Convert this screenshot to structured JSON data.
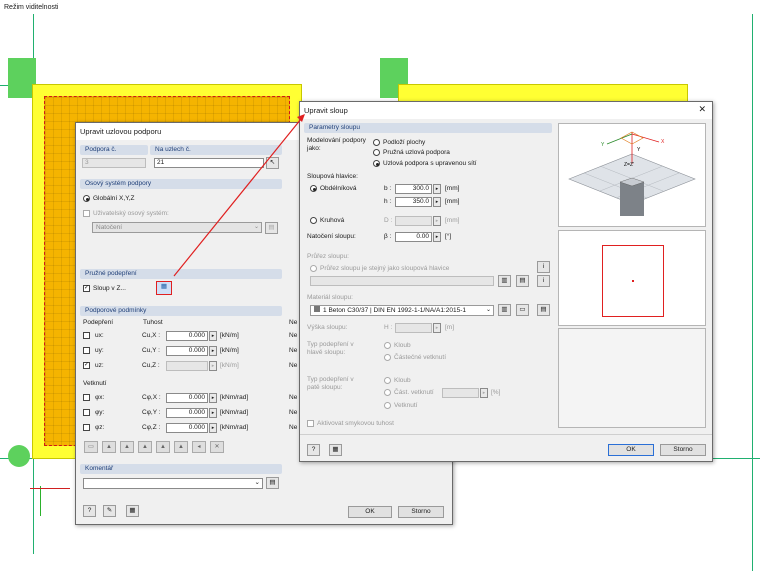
{
  "app": {
    "mode_label": "Režim viditelnosti"
  },
  "node_dialog": {
    "title": "Upravit uzlovou podporu",
    "support_no_label": "Podpora č.",
    "support_no": "3",
    "nodes_label": "Na uzlech č.",
    "nodes": "21",
    "axis_section": "Osový systém podpory",
    "axis_global": "Globální X,Y,Z",
    "axis_user": "Uživatelský osový systém:",
    "axis_rotation": "Natočení",
    "elastic_section": "Pružné podepření",
    "column_label": "Sloup v Z...",
    "conditions_section": "Podporové podmínky",
    "support_col": "Podepření",
    "stiffness_col": "Tuhost",
    "ne_col": "Ne",
    "translations": [
      {
        "label": "ux:",
        "checked": false,
        "symbol": "Cu,X :",
        "value": "0.000",
        "unit": "[kN/m]",
        "extra": "Ne"
      },
      {
        "label": "uy:",
        "checked": false,
        "symbol": "Cu,Y :",
        "value": "0.000",
        "unit": "[kN/m]",
        "extra": "Ne"
      },
      {
        "label": "uz:",
        "checked": true,
        "symbol": "Cu,Z :",
        "value": "",
        "unit": "[kN/m]",
        "extra": "Ne"
      }
    ],
    "rotation_label": "Vetknutí",
    "rotations": [
      {
        "label": "φx:",
        "checked": false,
        "symbol": "Cφ,X :",
        "value": "0.000",
        "unit": "[kNm/rad]",
        "extra": "Ne"
      },
      {
        "label": "φy:",
        "checked": false,
        "symbol": "Cφ,Y :",
        "value": "0.000",
        "unit": "[kNm/rad]",
        "extra": "Ne"
      },
      {
        "label": "φz:",
        "checked": false,
        "symbol": "Cφ,Z :",
        "value": "0.000",
        "unit": "[kNm/rad]",
        "extra": "Ne"
      }
    ],
    "comment_section": "Komentář",
    "ok": "OK",
    "cancel": "Storno"
  },
  "column_dialog": {
    "title": "Upravit sloup",
    "params_section": "Parametry sloupu",
    "modeling_label": "Modelování podpory jako:",
    "modeling_options": [
      "Podloží plochy",
      "Pružná uzlová podpora",
      "Uzlová podpora s upravenou sítí"
    ],
    "modeling_selected": 2,
    "head_label": "Sloupová hlavice:",
    "rect_label": "Obdélníková",
    "b_label": "b :",
    "b_value": "300.0",
    "b_unit": "[mm]",
    "h_label": "h :",
    "h_value": "350.0",
    "h_unit": "[mm]",
    "circ_label": "Kruhová",
    "d_label": "D :",
    "d_unit": "[mm]",
    "rot_label": "Natočení sloupu:",
    "beta_label": "β :",
    "beta_value": "0.00",
    "beta_unit": "[°]",
    "section_section": "Průřez sloupu:",
    "same_section": "Průřez sloupu je stejný jako sloupová hlavice",
    "material_section": "Materiál sloupu:",
    "material_no": "1",
    "material_value": "Beton C30/37  |  DIN EN 1992-1-1/NA/A1:2015-1",
    "height_label": "Výška sloupu:",
    "H_label": "H :",
    "H_unit": "[m]",
    "head_type_label": "Typ podepření v hlavě sloupu:",
    "head_options": [
      "Kloub",
      "Částečné vetknutí"
    ],
    "foot_type_label": "Typ podepření v patě sloupu:",
    "foot_options": [
      "Kloub",
      "Část. vetknutí",
      "Vetknutí"
    ],
    "foot_percent_unit": "[%]",
    "shear_label": "Aktivovat smykovou tuhost",
    "ok": "OK",
    "cancel": "Storno"
  },
  "colors": {
    "accent": "#1f3f78",
    "callout": "#e02020",
    "slab": "#ffff33",
    "support": "#5dd15d"
  }
}
